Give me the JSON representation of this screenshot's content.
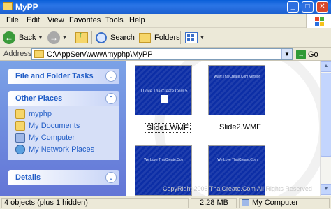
{
  "window": {
    "title": "MyPP"
  },
  "menu": [
    "File",
    "Edit",
    "View",
    "Favorites",
    "Tools",
    "Help"
  ],
  "toolbar": {
    "back_label": "Back",
    "search_label": "Search",
    "folders_label": "Folders"
  },
  "address": {
    "label": "Address",
    "path": "C:\\AppServ\\www\\myphp\\MyPP",
    "go_label": "Go"
  },
  "tasks": {
    "file_folder_tasks": "File and Folder Tasks",
    "other_places": {
      "title": "Other Places",
      "items": [
        "myphp",
        "My Documents",
        "My Computer",
        "My Network Places"
      ]
    },
    "details": "Details"
  },
  "files": [
    {
      "name": "Slide1.WMF",
      "line1": "I Love ThaiCreate.Com 5",
      "selected": true
    },
    {
      "name": "Slide2.WMF",
      "line1": "www.ThaiCreate.Com Version"
    },
    {
      "name": "",
      "line1": "We Love ThaiCreate.Com"
    },
    {
      "name": "",
      "line1": "We Love ThaiCreate.Com"
    }
  ],
  "watermark_text": "CopyRight 2006 ThaiCreate.Com All Rights Reserved",
  "status": {
    "objects": "4 objects (plus 1 hidden)",
    "size": "2.28 MB",
    "location": "My Computer"
  },
  "colors": {
    "titlebar": "#0a5fd8",
    "taskpane": "#7ba2e7",
    "link": "#215dc6",
    "slide_bg": "#0c2ea6"
  },
  "icons": [
    "folder-icon",
    "back-arrow-icon",
    "forward-arrow-icon",
    "up-folder-icon",
    "search-icon",
    "folders-icon",
    "views-icon",
    "go-arrow-icon",
    "chevron-up-icon",
    "chevron-down-icon",
    "computer-icon"
  ]
}
